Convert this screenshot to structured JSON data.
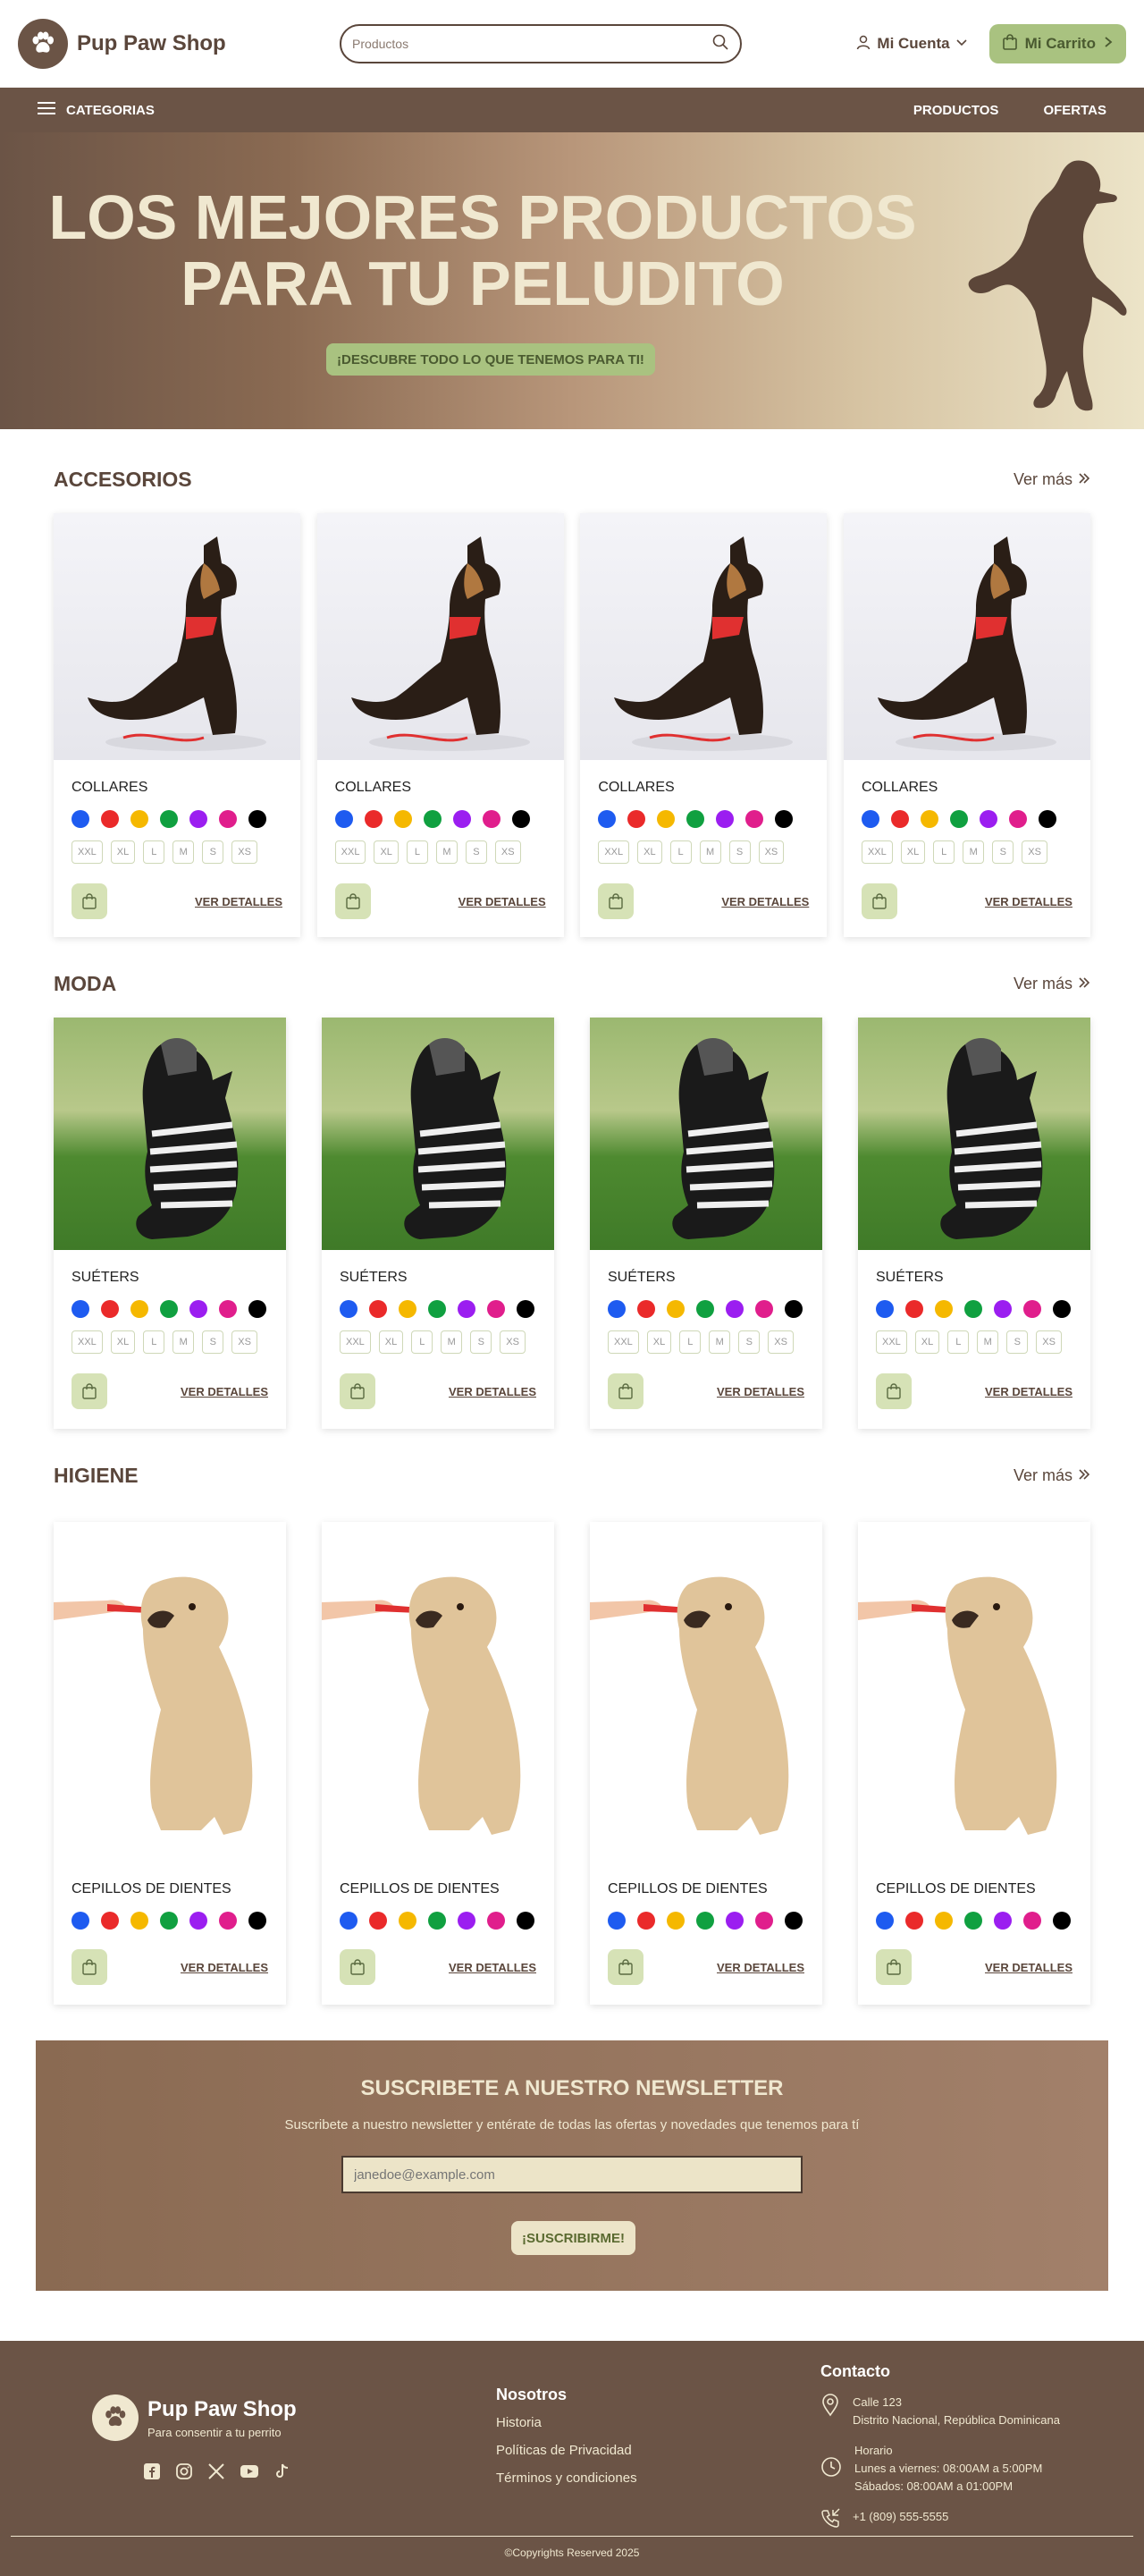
{
  "header": {
    "brand": "Pup Paw Shop",
    "search_placeholder": "Productos",
    "account_label": "Mi Cuenta",
    "cart_label": "Mi Carrito"
  },
  "nav": {
    "categories_label": "CATEGORIAS",
    "products_label": "PRODUCTOS",
    "offers_label": "OFERTAS"
  },
  "hero": {
    "title_line1": "LOS MEJORES PRODUCTOS",
    "title_line2": "PARA TU PELUDITO",
    "cta": "¡DESCUBRE TODO LO QUE TENEMOS PARA TI!"
  },
  "colors": [
    "#1e5bf0",
    "#ea2a2a",
    "#f5b800",
    "#10a040",
    "#9b1ef0",
    "#e01e8c",
    "#000000"
  ],
  "sizes": [
    "XXL",
    "XL",
    "L",
    "M",
    "S",
    "XS"
  ],
  "sections": [
    {
      "title": "ACCESORIOS",
      "see_more": "Ver más",
      "products": [
        {
          "name": "COLLARES",
          "details": "VER DETALLES"
        },
        {
          "name": "COLLARES",
          "details": "VER DETALLES"
        },
        {
          "name": "COLLARES",
          "details": "VER DETALLES"
        },
        {
          "name": "COLLARES",
          "details": "VER DETALLES"
        }
      ]
    },
    {
      "title": "MODA",
      "see_more": "Ver más",
      "products": [
        {
          "name": "SUÉTERS",
          "details": "VER DETALLES"
        },
        {
          "name": "SUÉTERS",
          "details": "VER DETALLES"
        },
        {
          "name": "SUÉTERS",
          "details": "VER DETALLES"
        },
        {
          "name": "SUÉTERS",
          "details": "VER DETALLES"
        }
      ]
    },
    {
      "title": "HIGIENE",
      "see_more": "Ver más",
      "products": [
        {
          "name": "CEPILLOS DE DIENTES",
          "details": "VER DETALLES"
        },
        {
          "name": "CEPILLOS DE DIENTES",
          "details": "VER DETALLES"
        },
        {
          "name": "CEPILLOS DE DIENTES",
          "details": "VER DETALLES"
        },
        {
          "name": "CEPILLOS DE DIENTES",
          "details": "VER DETALLES"
        }
      ]
    }
  ],
  "newsletter": {
    "title": "SUSCRIBETE A NUESTRO NEWSLETTER",
    "subtitle": "Suscribete a nuestro newsletter y entérate de todas las ofertas y novedades que tenemos para tí",
    "email_placeholder": "janedoe@example.com",
    "button": "¡SUSCRIBIRME!"
  },
  "footer": {
    "brand": "Pup Paw Shop",
    "tagline": "Para consentir a tu perrito",
    "about_title": "Nosotros",
    "links": [
      "Historia",
      "Políticas de Privacidad",
      "Términos y condiciones"
    ],
    "contact_title": "Contacto",
    "address_line1": "Calle 123",
    "address_line2": "Distrito Nacional, República Dominicana",
    "hours_title": "Horario",
    "hours_line1": "Lunes a viernes: 08:00AM a 5:00PM",
    "hours_line2": "Sábados: 08:00AM a 01:00PM",
    "phone": "+1 (809) 555-5555",
    "copyright": "©Copyrights Reserved 2025"
  }
}
